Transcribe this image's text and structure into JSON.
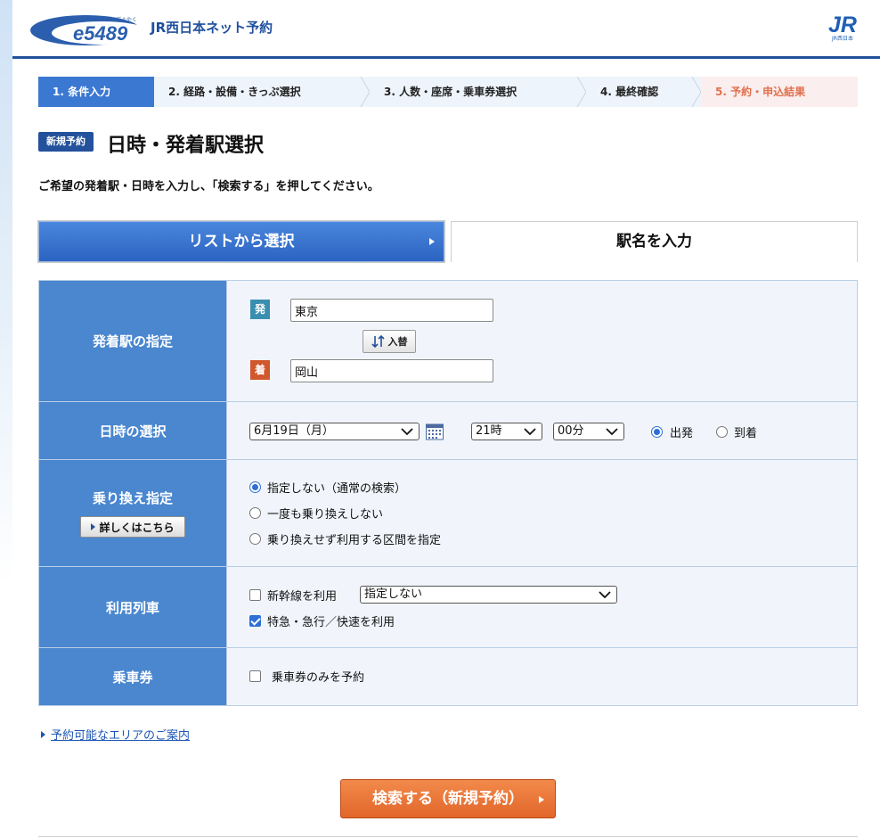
{
  "header": {
    "logo_text": "e5489",
    "logo_ruby": "いいごよやく",
    "service_name": "JR西日本ネット予約",
    "company_logo_text": "JR",
    "company_logo_sub": "JR西日本"
  },
  "steps": [
    {
      "label": "1. 条件入力",
      "state": "active"
    },
    {
      "label": "2. 経路・設備・きっぷ選択",
      "state": "pending"
    },
    {
      "label": "3. 人数・座席・乗車券選択",
      "state": "pending"
    },
    {
      "label": "4. 最終確認",
      "state": "pending"
    },
    {
      "label": "5. 予約・申込結果",
      "state": "final"
    }
  ],
  "page": {
    "badge": "新規予約",
    "title": "日時・発着駅選択",
    "instruction": "ご希望の発着駅・日時を入力し、「検索する」を押してください。"
  },
  "tabs": {
    "list_select": "リストから選択",
    "station_input": "駅名を入力"
  },
  "form": {
    "stations": {
      "label": "発着駅の指定",
      "departure_icon": "発",
      "departure_value": "東京",
      "swap_label": "入替",
      "arrival_icon": "着",
      "arrival_value": "岡山"
    },
    "datetime": {
      "label": "日時の選択",
      "date_value": "6月19日（月）",
      "hour_value": "21時",
      "minute_value": "00分",
      "depart_label": "出発",
      "arrive_label": "到着",
      "selected": "depart"
    },
    "transfer": {
      "label": "乗り換え指定",
      "detail_button": "詳しくはこちら",
      "options": [
        {
          "label": "指定しない（通常の検索）",
          "checked": true
        },
        {
          "label": "一度も乗り換えしない",
          "checked": false
        },
        {
          "label": "乗り換えせず利用する区間を指定",
          "checked": false
        }
      ]
    },
    "trains": {
      "label": "利用列車",
      "shinkansen_label": "新幹線を利用",
      "shinkansen_checked": false,
      "shinkansen_select": "指定しない",
      "express_label": "特急・急行／快速を利用",
      "express_checked": true
    },
    "ticket": {
      "label": "乗車券",
      "option_label": "乗車券のみを予約",
      "checked": false
    }
  },
  "links": {
    "area_guide": "予約可能なエリアのご案内"
  },
  "search_button": "検索する（新規予約）",
  "colors": {
    "brand_blue": "#23519b",
    "row_head": "#4a87cf",
    "search_orange": "#e2662a",
    "departure_icon": "#3a8fb0",
    "arrival_icon": "#d0582c"
  }
}
